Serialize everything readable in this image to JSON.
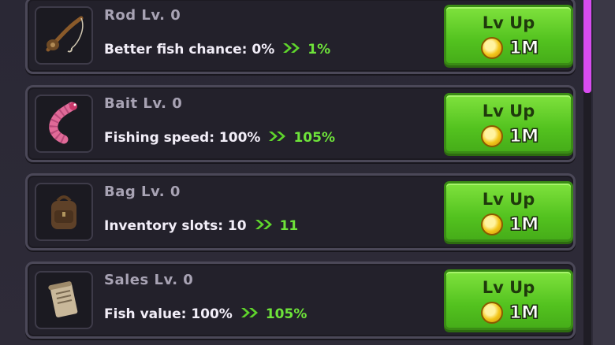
{
  "colors": {
    "button_green": "#5fd02a",
    "next_value_green": "#6ee33a",
    "scrollbar_thumb": "#d84cf0",
    "card_bg": "#23212b"
  },
  "upgrades": [
    {
      "icon": "fishing-rod-icon",
      "title": "Rod Lv. 0",
      "stat_label": "Better fish chance:",
      "current": "0%",
      "next": "1%",
      "button_label": "Lv Up",
      "cost": "1M"
    },
    {
      "icon": "worm-bait-icon",
      "title": "Bait Lv. 0",
      "stat_label": "Fishing speed:",
      "current": "100%",
      "next": "105%",
      "button_label": "Lv Up",
      "cost": "1M"
    },
    {
      "icon": "backpack-icon",
      "title": "Bag Lv. 0",
      "stat_label": "Inventory slots:",
      "current": "10",
      "next": "11",
      "button_label": "Lv Up",
      "cost": "1M"
    },
    {
      "icon": "scroll-icon",
      "title": "Sales Lv. 0",
      "stat_label": "Fish value:",
      "current": "100%",
      "next": "105%",
      "button_label": "Lv Up",
      "cost": "1M"
    }
  ]
}
